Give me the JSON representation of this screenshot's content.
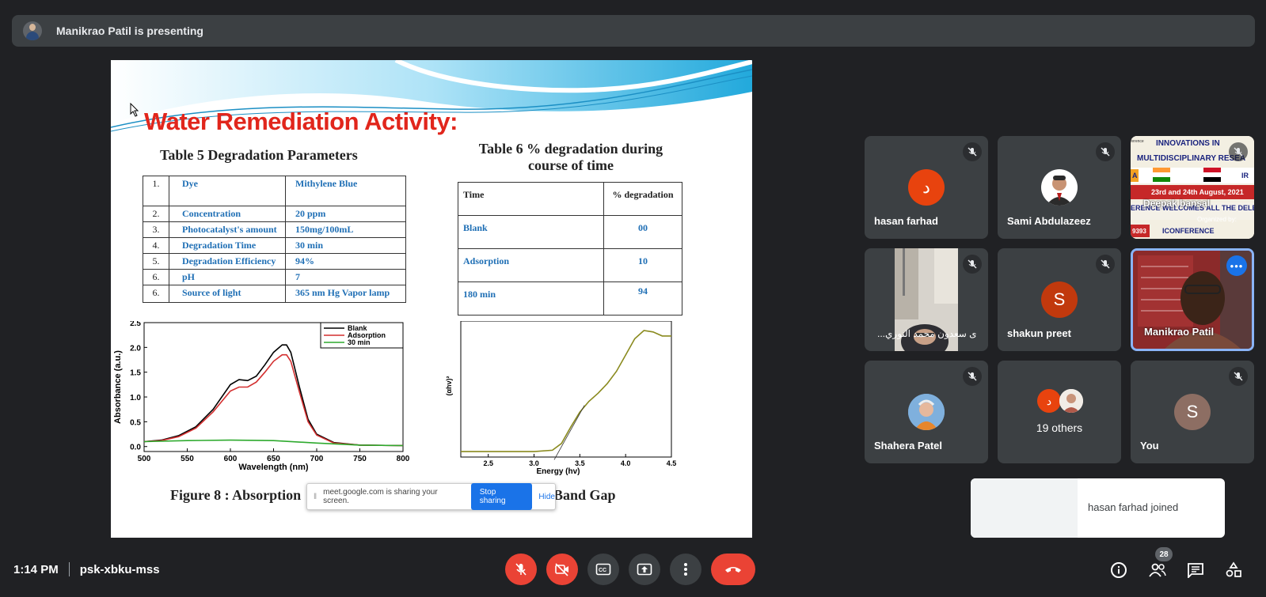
{
  "presenting": {
    "text": "Manikrao Patil is presenting"
  },
  "slide": {
    "title": "Water Remediation Activity:",
    "table5": {
      "title": "Table 5 Degradation Parameters",
      "rows": [
        {
          "num": "1.",
          "param": "Dye",
          "value": "Mithylene Blue"
        },
        {
          "num": "2.",
          "param": "Concentration",
          "value": "20 ppm"
        },
        {
          "num": "3.",
          "param": "Photocatalyst's amount",
          "value": "150mg/100mL"
        },
        {
          "num": "4.",
          "param": "Degradation Time",
          "value": "30 min"
        },
        {
          "num": "5.",
          "param": "Degradation Efficiency",
          "value": "94%"
        },
        {
          "num": "6.",
          "param": "pH",
          "value": "7"
        },
        {
          "num": "6.",
          "param": "Source of light",
          "value": "365 nm Hg Vapor lamp"
        }
      ]
    },
    "table6": {
      "title_line1": "Table 6 % degradation during",
      "title_line2": "course of time",
      "header": {
        "time": "Time",
        "deg": "% degradation"
      },
      "rows": [
        {
          "time": "Blank",
          "deg": "00"
        },
        {
          "time": "Adsorption",
          "deg": "10"
        },
        {
          "time": "180 min",
          "deg": "94"
        }
      ]
    },
    "fig_caption_left": "Figure 8 : Absorption",
    "fig_caption_right": "Band Gap"
  },
  "chart_data": [
    {
      "type": "line",
      "xlabel": "Wavelength (nm)",
      "ylabel": "Absorbance (a.u.)",
      "xlim": [
        500,
        800
      ],
      "ylim": [
        -0.1,
        2.5
      ],
      "xticks": [
        "500",
        "550",
        "600",
        "650",
        "700",
        "750",
        "800"
      ],
      "yticks": [
        "0.0",
        "0.5",
        "1.0",
        "1.5",
        "2.0",
        "2.5"
      ],
      "legend": "top-right",
      "series": [
        {
          "name": "Blank",
          "color": "#000000",
          "x": [
            500,
            520,
            540,
            560,
            580,
            600,
            610,
            620,
            630,
            640,
            650,
            660,
            665,
            670,
            680,
            690,
            700,
            720,
            750,
            800
          ],
          "y": [
            0.1,
            0.13,
            0.22,
            0.4,
            0.75,
            1.25,
            1.35,
            1.33,
            1.42,
            1.65,
            1.9,
            2.05,
            2.05,
            1.9,
            1.2,
            0.55,
            0.25,
            0.08,
            0.03,
            0.02
          ]
        },
        {
          "name": "Adsorption",
          "color": "#d32f2f",
          "x": [
            500,
            520,
            540,
            560,
            580,
            600,
            610,
            620,
            630,
            640,
            650,
            660,
            665,
            670,
            680,
            690,
            700,
            720,
            750,
            800
          ],
          "y": [
            0.1,
            0.12,
            0.2,
            0.37,
            0.7,
            1.12,
            1.2,
            1.2,
            1.3,
            1.5,
            1.72,
            1.85,
            1.85,
            1.72,
            1.1,
            0.5,
            0.23,
            0.07,
            0.03,
            0.02
          ]
        },
        {
          "name": "30 min",
          "color": "#2eaa2e",
          "x": [
            500,
            550,
            600,
            650,
            700,
            750,
            800
          ],
          "y": [
            0.1,
            0.12,
            0.13,
            0.12,
            0.07,
            0.03,
            0.02
          ]
        }
      ]
    },
    {
      "type": "line",
      "xlabel": "Energy (hv)",
      "ylabel": "(αhν)²",
      "xlim": [
        2.2,
        4.5
      ],
      "xticks": [
        "2.5",
        "3.0",
        "3.5",
        "4.0",
        "4.5"
      ],
      "series": [
        {
          "name": "",
          "color": "#8a8a1e",
          "x": [
            2.2,
            2.6,
            3.0,
            3.2,
            3.3,
            3.4,
            3.5,
            3.6,
            3.7,
            3.8,
            3.9,
            4.0,
            4.1,
            4.2,
            4.3,
            4.4,
            4.5
          ],
          "y": [
            0.04,
            0.04,
            0.04,
            0.05,
            0.1,
            0.22,
            0.33,
            0.41,
            0.47,
            0.54,
            0.63,
            0.75,
            0.87,
            0.93,
            0.92,
            0.89,
            0.89
          ]
        }
      ]
    }
  ],
  "share_notice": {
    "text": "meet.google.com is sharing your screen.",
    "stop": "Stop sharing",
    "hide": "Hide"
  },
  "participants": [
    {
      "name": "hasan farhad",
      "initial": "د",
      "color": "#e8430e"
    },
    {
      "name": "Sami Abdulazeez"
    },
    {
      "name": "Deepak bansal"
    },
    {
      "name": "...ى سعدون محمد النوري"
    },
    {
      "name": "shakun preet",
      "initial": "S",
      "color": "#c1390d"
    },
    {
      "name": "Manikrao Patil"
    },
    {
      "name": "Shahera Patel"
    },
    {
      "name": "19 others",
      "initial": "د"
    },
    {
      "name": "You",
      "initial": "S",
      "color": "#8d6e63"
    }
  ],
  "banner": {
    "line1": "INNOVATIONS IN",
    "line2": "MULTIDISCIPLINARY RESEA",
    "date": "23rd and 24th August, 2021",
    "welcome": "ERENCE WELCOMES ALL THE DELE",
    "org": "Organized by:",
    "code": "9393",
    "conf": "ICONFERENCE",
    "left_frag": "ference",
    "a": "A",
    "ir": "IR"
  },
  "toast": {
    "text": "hasan farhad joined"
  },
  "meeting": {
    "time": "1:14 PM",
    "code": "psk-xbku-mss"
  },
  "people_count": "28",
  "icons": [
    "mic-off-icon",
    "camera-off-icon",
    "captions-icon",
    "present-icon",
    "more-icon",
    "hangup-icon",
    "info-icon",
    "people-icon",
    "chat-icon",
    "activities-icon"
  ]
}
